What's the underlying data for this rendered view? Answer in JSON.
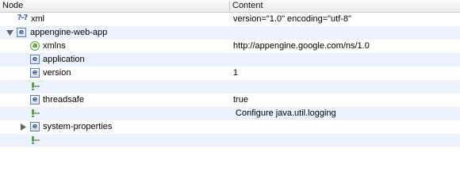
{
  "header": {
    "node": "Node",
    "content": "Content"
  },
  "rows": [
    {
      "node": "xml",
      "content": "version=\"1.0\" encoding=\"utf-8\"",
      "icon": "pi-icon",
      "pi_text": "?-?"
    },
    {
      "node": "appengine-web-app",
      "content": "",
      "icon": "element-icon",
      "expanded": true
    },
    {
      "node": "xmlns",
      "content": "http://appengine.google.com/ns/1.0",
      "icon": "attribute-icon"
    },
    {
      "node": "application",
      "content": "",
      "icon": "element-icon"
    },
    {
      "node": "version",
      "content": "1",
      "icon": "element-icon"
    },
    {
      "node": "--",
      "content": "",
      "icon": "comment-icon"
    },
    {
      "node": "threadsafe",
      "content": "true",
      "icon": "element-icon"
    },
    {
      "node": "--",
      "content": " Configure java.util.logging",
      "icon": "comment-icon"
    },
    {
      "node": "system-properties",
      "content": "",
      "icon": "element-icon",
      "expanded": false
    },
    {
      "node": "--",
      "content": "",
      "icon": "comment-icon"
    }
  ],
  "icons": {
    "element_letter": "e",
    "attribute_letter": "a"
  },
  "colors": {
    "row_alt": "#edf3fe",
    "element_icon": "#5d7fb5",
    "attribute_icon": "#6aa04a",
    "comment_icon": "#5aa43a"
  }
}
